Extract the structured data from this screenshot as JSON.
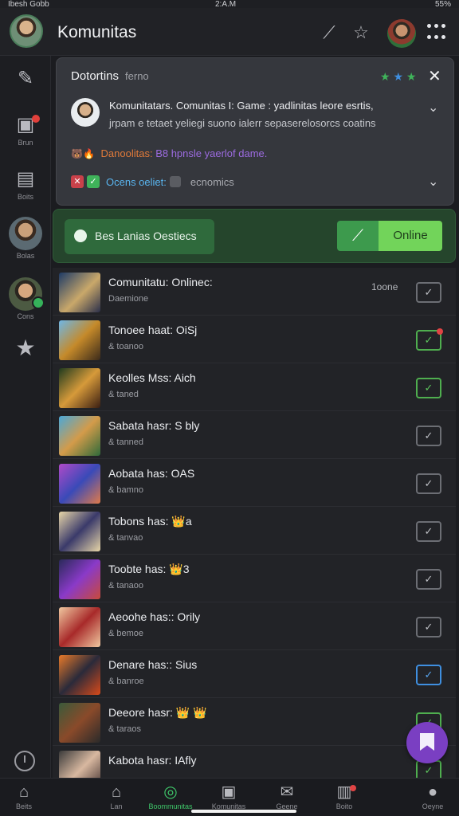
{
  "status_bar": {
    "left": "Ibesh Gobb",
    "time": "2:A.M",
    "right": "55%"
  },
  "header": {
    "title": "Komunitas"
  },
  "sidebar": {
    "items": [
      {
        "label": ""
      },
      {
        "label": "Brun"
      },
      {
        "label": "Boits"
      },
      {
        "label": "Bolas"
      },
      {
        "label": "Cons"
      },
      {
        "label": ""
      }
    ]
  },
  "notification": {
    "title": "Dotortins",
    "subtitle": "ferno",
    "line1": "Komunitatars. Comunitas I: Game : yadlinitas leore esrtis,",
    "line2": "jrpam e tetaet yeliegi suono ialerr sepaserelosorcs coatins",
    "row3_label": "Danoolitas:",
    "row3_value": "B8 hpnsle yaerlof dame.",
    "row4_label": "Ocens oeliet:",
    "row4_value": "ecnomics"
  },
  "banner": {
    "pill_text": "Bes Lanias Oestiecs",
    "online_label": "Online"
  },
  "rows": [
    {
      "title": "Comunitatu: Onlinec:",
      "sub": "Daemione",
      "meta": "1oone",
      "check": "gray"
    },
    {
      "title": "Tonoee haat: OiSj",
      "sub": "& toanoo",
      "meta": "",
      "check": "green-dot"
    },
    {
      "title": "Keolles Mss: Aich",
      "sub": "& taned",
      "meta": "",
      "check": "green"
    },
    {
      "title": "Sabata hasr: S bly",
      "sub": "& tanned",
      "meta": "",
      "check": "gray"
    },
    {
      "title": "Aobata has: OAS",
      "sub": "& bamno",
      "meta": "",
      "check": "gray"
    },
    {
      "title": "Tobons has: 👑a",
      "sub": "& tanvao",
      "meta": "",
      "check": "gray"
    },
    {
      "title": "Toobte has: 👑3",
      "sub": "& tanaoo",
      "meta": "",
      "check": "gray"
    },
    {
      "title": "Aeoohe has:: Orily",
      "sub": "& bemoe",
      "meta": "",
      "check": "gray"
    },
    {
      "title": "Denare has:: Sius",
      "sub": "& banroe",
      "meta": "",
      "check": "blue"
    },
    {
      "title": "Deeore hasr: 👑 👑",
      "sub": "& taraos",
      "meta": "",
      "check": "green"
    },
    {
      "title": "Kabota hasr: IAfly",
      "sub": "",
      "meta": "",
      "check": "gray"
    }
  ],
  "bottom_nav": [
    {
      "label": "Beits",
      "icon": "home-icon"
    },
    {
      "label": "Lan",
      "icon": "house-icon"
    },
    {
      "label": "Boommunitas",
      "icon": "community-icon"
    },
    {
      "label": "Komunitas",
      "icon": "screen-icon"
    },
    {
      "label": "Geene",
      "icon": "mail-icon"
    },
    {
      "label": "Boito",
      "icon": "bag-icon"
    },
    {
      "label": "Oeyne",
      "icon": "profile-icon"
    }
  ]
}
